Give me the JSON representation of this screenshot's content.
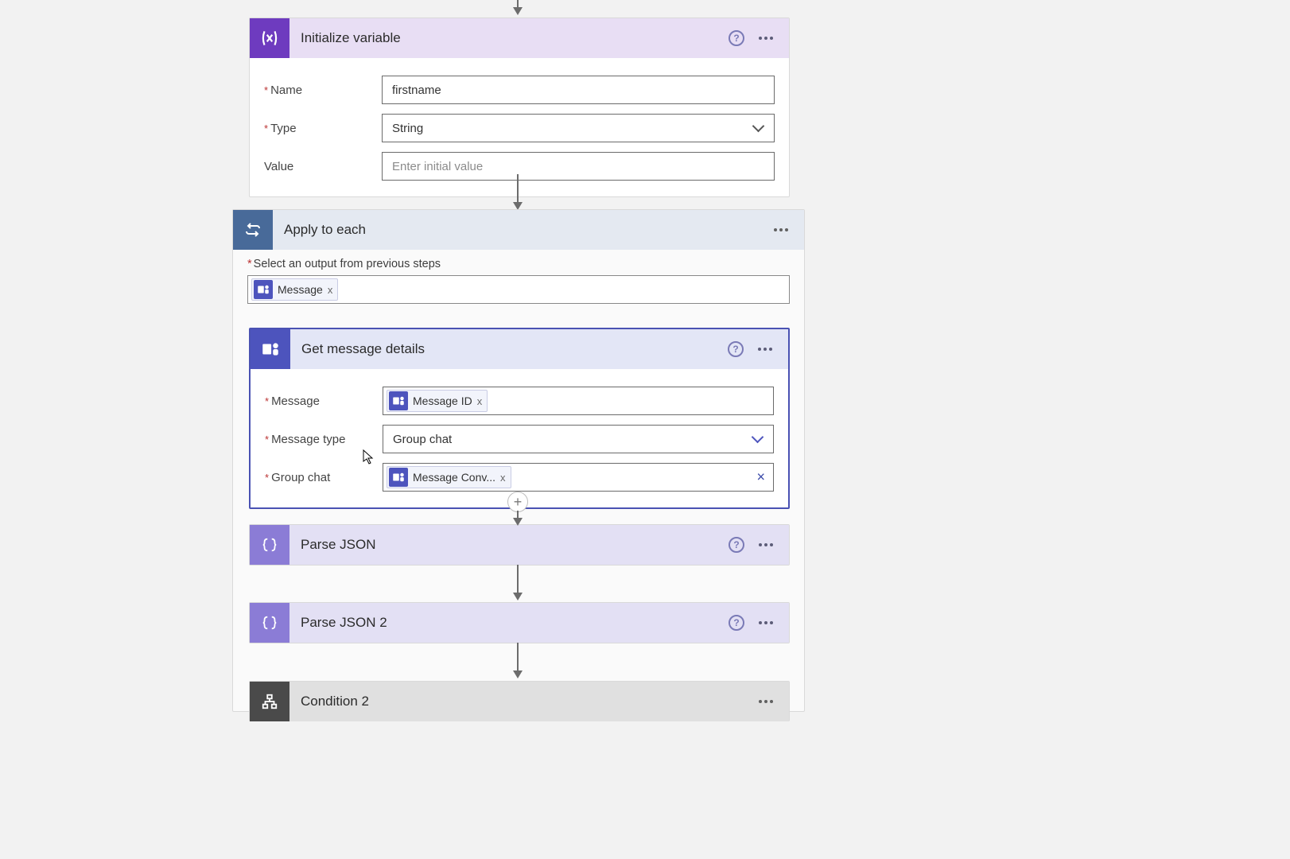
{
  "steps": {
    "init_var": {
      "title": "Initialize variable",
      "fields": {
        "name_label": "Name",
        "name_value": "firstname",
        "type_label": "Type",
        "type_value": "String",
        "value_label": "Value",
        "value_placeholder": "Enter initial value"
      }
    },
    "apply_each": {
      "title": "Apply to each",
      "select_output_label": "Select an output from previous steps",
      "token": "Message"
    },
    "get_msg": {
      "title": "Get message details",
      "fields": {
        "message_label": "Message",
        "message_token": "Message ID",
        "type_label": "Message type",
        "type_value": "Group chat",
        "chat_label": "Group chat",
        "chat_token": "Message Conv..."
      }
    },
    "parse1": {
      "title": "Parse JSON"
    },
    "parse2": {
      "title": "Parse JSON 2"
    },
    "cond2": {
      "title": "Condition 2"
    }
  },
  "glyphs": {
    "help": "?",
    "remove": "x",
    "clear": "×",
    "plus": "+"
  }
}
